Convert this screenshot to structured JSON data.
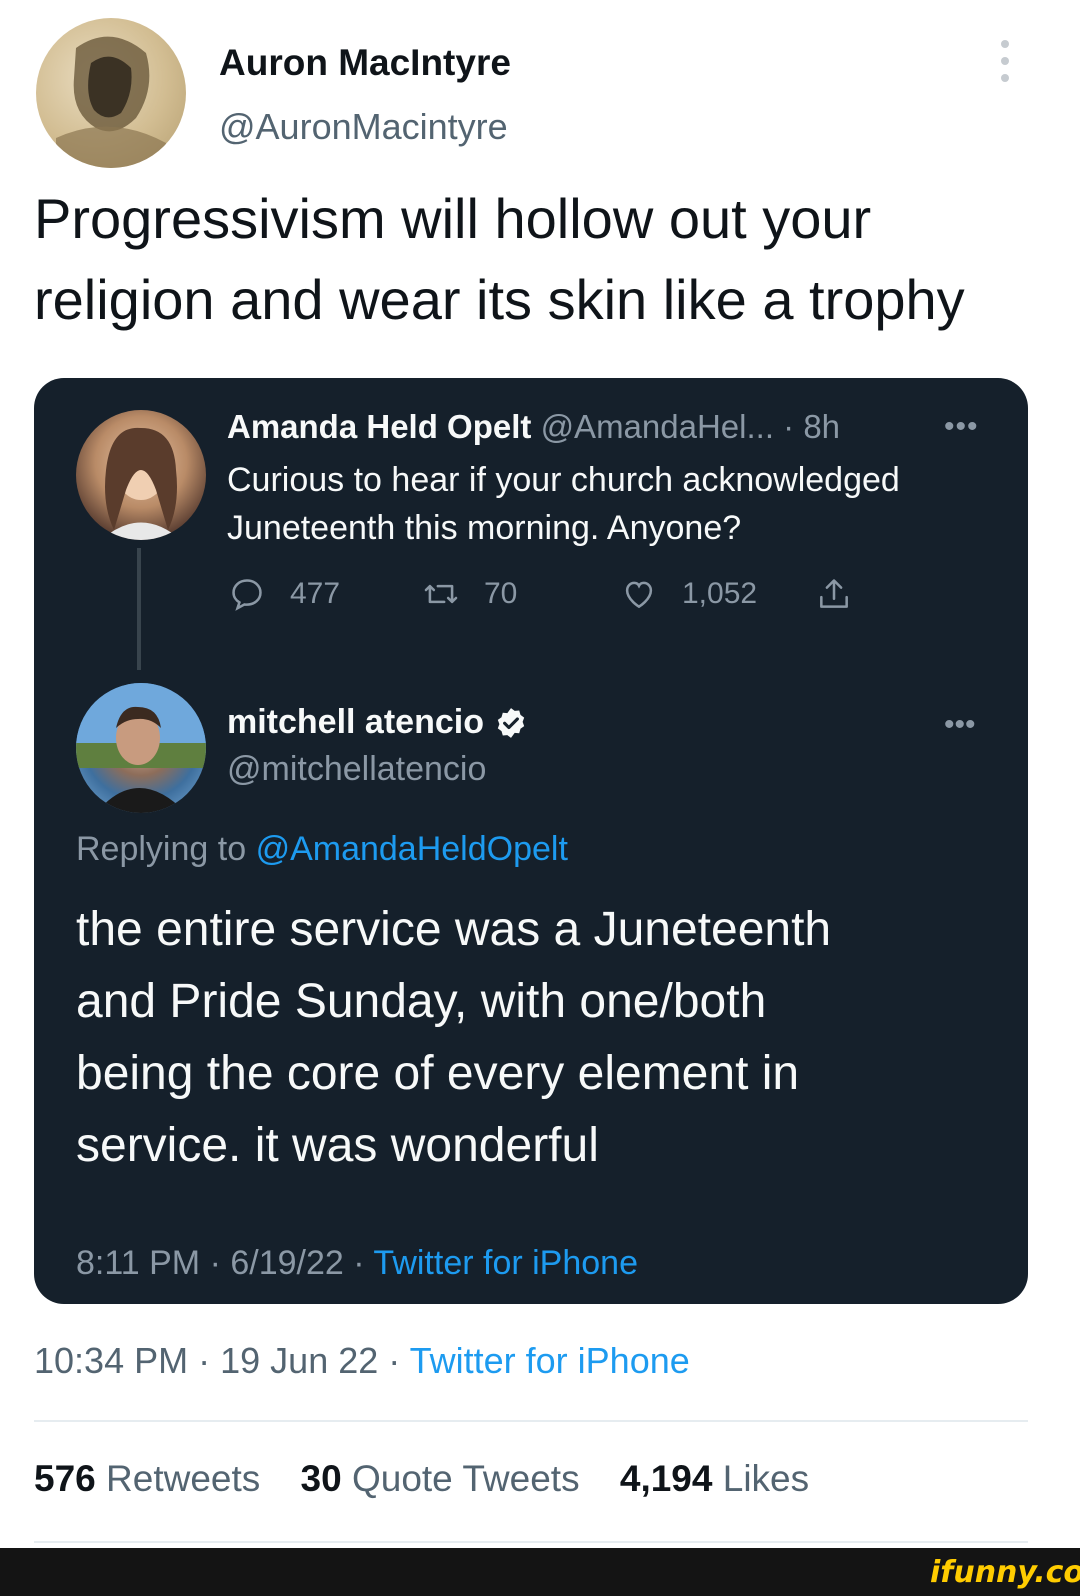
{
  "tweet": {
    "author_name": "Auron MacIntyre",
    "author_handle": "@AuronMacintyre",
    "text": "Progressivism will hollow out your\nreligion and wear its skin like a trophy",
    "time": "10:34 PM",
    "date": "19 Jun 22",
    "source": "Twitter for iPhone",
    "separator": "·",
    "retweets_count": "576",
    "retweets_label": "Retweets",
    "quote_tweets_count": "30",
    "quote_tweets_label": "Quote Tweets",
    "likes_count": "4,194",
    "likes_label": "Likes"
  },
  "quoted": {
    "parent": {
      "name": "Amanda Held Opelt",
      "handle": "@AmandaHel...",
      "age": "· 8h",
      "text": "Curious to hear if your church acknowledged\nJuneteenth this morning.  Anyone?",
      "replies": "477",
      "retweets": "70",
      "likes": "1,052"
    },
    "reply": {
      "name": "mitchell atencio",
      "handle": "@mitchellatencio",
      "replying_prefix": "Replying to",
      "replying_handle": "@AmandaHeldOpelt",
      "text": "the entire service was a Juneteenth\nand Pride Sunday, with one/both\nbeing the core of every element in\nservice. it was wonderful",
      "time": "8:11 PM",
      "date": "6/19/22",
      "source": "Twitter for iPhone"
    }
  },
  "watermark": "ifunny.co",
  "colors": {
    "card_bg": "#15202b",
    "link": "#1d9bf0",
    "muted_dark": "#8b98a5",
    "muted_light": "#536471"
  },
  "icons": [
    "more-vertical-icon",
    "more-horizontal-icon",
    "reply-icon",
    "retweet-icon",
    "like-icon",
    "share-icon",
    "verified-badge-icon"
  ]
}
